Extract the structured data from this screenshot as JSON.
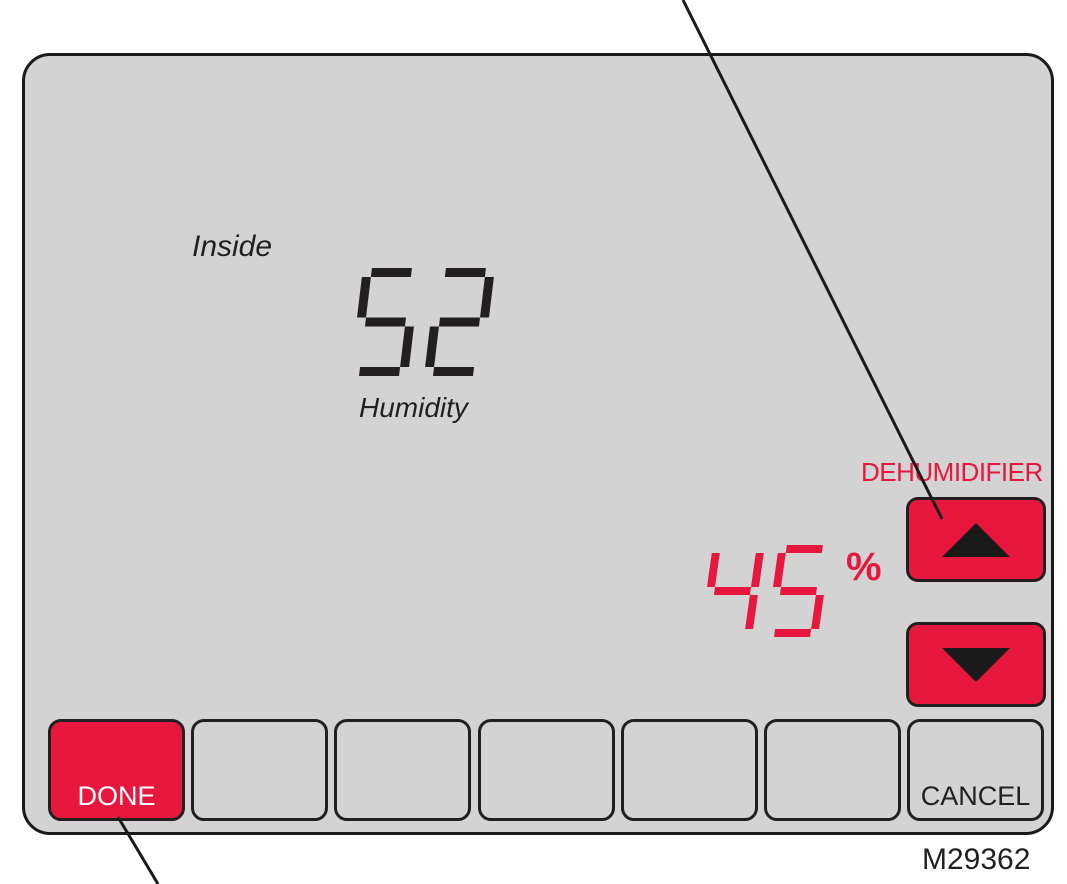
{
  "display": {
    "inside_label": "Inside",
    "inside_humidity_value": "52",
    "humidity_label": "Humidity",
    "dehumidifier_label": "DEHUMIDIFIER",
    "setpoint_value": "45",
    "setpoint_unit": "%"
  },
  "buttons": {
    "up_icon": "triangle-up-icon",
    "down_icon": "triangle-down-icon",
    "done_label": "DONE",
    "cancel_label": "CANCEL"
  },
  "model_code": "M29362",
  "colors": {
    "screen_background": "#d3d3d3",
    "accent_red": "#e8173d",
    "outline": "#231f20"
  }
}
